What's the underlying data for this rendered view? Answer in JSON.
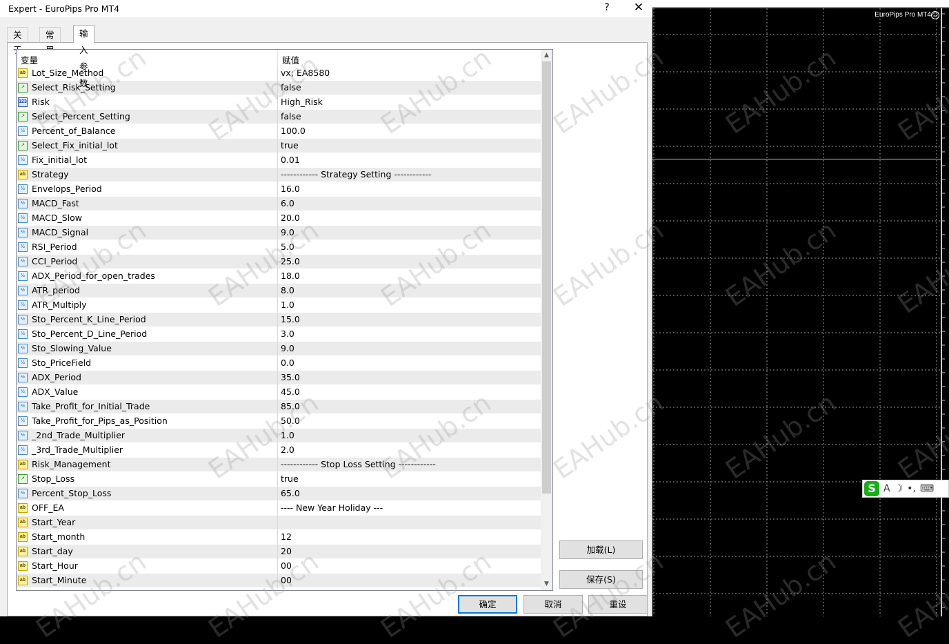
{
  "window": {
    "title": "Expert - EuroPips Pro MT4",
    "help_label": "?",
    "close_label": "✕"
  },
  "tabs": [
    {
      "label": "关于",
      "active": false
    },
    {
      "label": "常用",
      "active": false
    },
    {
      "label": "输入参数",
      "active": true
    }
  ],
  "grid": {
    "col_variable": "变量",
    "col_value": "赋值",
    "rows": [
      {
        "type": "ab",
        "name": "Lot_Size_Method",
        "value": "vx; EA8580"
      },
      {
        "type": "bool",
        "name": "Select_Risk_Setting",
        "value": "false"
      },
      {
        "type": "num",
        "name": "Risk",
        "value": "High_Risk"
      },
      {
        "type": "bool",
        "name": "Select_Percent_Setting",
        "value": "false"
      },
      {
        "type": "dbl",
        "name": "Percent_of_Balance",
        "value": "100.0"
      },
      {
        "type": "bool",
        "name": "Select_Fix_initial_lot",
        "value": "true"
      },
      {
        "type": "dbl",
        "name": "Fix_initial_lot",
        "value": "0.01"
      },
      {
        "type": "ab",
        "name": "Strategy",
        "value": "------------ Strategy Setting ------------"
      },
      {
        "type": "dbl",
        "name": "Envelops_Period",
        "value": "16.0"
      },
      {
        "type": "dbl",
        "name": "MACD_Fast",
        "value": "6.0"
      },
      {
        "type": "dbl",
        "name": "MACD_Slow",
        "value": "20.0"
      },
      {
        "type": "dbl",
        "name": "MACD_Signal",
        "value": "9.0"
      },
      {
        "type": "dbl",
        "name": "RSI_Period",
        "value": "5.0"
      },
      {
        "type": "dbl",
        "name": "CCI_Period",
        "value": "25.0"
      },
      {
        "type": "dbl",
        "name": "ADX_Period_for_open_trades",
        "value": "18.0"
      },
      {
        "type": "dbl",
        "name": "ATR_period",
        "value": "8.0"
      },
      {
        "type": "dbl",
        "name": "ATR_Multiply",
        "value": "1.0"
      },
      {
        "type": "dbl",
        "name": "Sto_Percent_K_Line_Period",
        "value": "15.0"
      },
      {
        "type": "dbl",
        "name": "Sto_Percent_D_Line_Period",
        "value": "3.0"
      },
      {
        "type": "dbl",
        "name": "Sto_Slowing_Value",
        "value": "9.0"
      },
      {
        "type": "dbl",
        "name": "Sto_PriceField",
        "value": "0.0"
      },
      {
        "type": "dbl",
        "name": "ADX_Period",
        "value": "35.0"
      },
      {
        "type": "dbl",
        "name": "ADX_Value",
        "value": "45.0"
      },
      {
        "type": "dbl",
        "name": "Take_Profit_for_Initial_Trade",
        "value": "85.0"
      },
      {
        "type": "dbl",
        "name": "Take_Profit_for_Pips_as_Position",
        "value": "50.0"
      },
      {
        "type": "dbl",
        "name": "_2nd_Trade_Multiplier",
        "value": "1.0"
      },
      {
        "type": "dbl",
        "name": "_3rd_Trade_Multiplier",
        "value": "2.0"
      },
      {
        "type": "ab",
        "name": "Risk_Management",
        "value": "------------ Stop Loss Setting ------------"
      },
      {
        "type": "bool",
        "name": "Stop_Loss",
        "value": "true"
      },
      {
        "type": "dbl",
        "name": "Percent_Stop_Loss",
        "value": "65.0"
      },
      {
        "type": "ab",
        "name": "OFF_EA",
        "value": "---- New Year Holiday ---"
      },
      {
        "type": "ab",
        "name": "Start_Year",
        "value": ""
      },
      {
        "type": "ab",
        "name": "Start_month",
        "value": "12"
      },
      {
        "type": "ab",
        "name": "Start_day",
        "value": "20"
      },
      {
        "type": "ab",
        "name": "Start_Hour",
        "value": "00"
      },
      {
        "type": "ab",
        "name": "Start_Minute",
        "value": "00"
      }
    ]
  },
  "icon_labels": {
    "ab": "ab",
    "bool": "↗",
    "num": "123",
    "dbl": "½"
  },
  "buttons": {
    "load": "加载(L)",
    "save": "保存(S)",
    "ok": "确定",
    "cancel": "取消",
    "reset": "重设"
  },
  "chart": {
    "title": "EuroPips Pro MT4",
    "smiley": "☺"
  },
  "ime": {
    "logo": "S",
    "items": [
      "A",
      "☽",
      "•,",
      "⌨"
    ]
  },
  "watermark": "EAHub.cn"
}
